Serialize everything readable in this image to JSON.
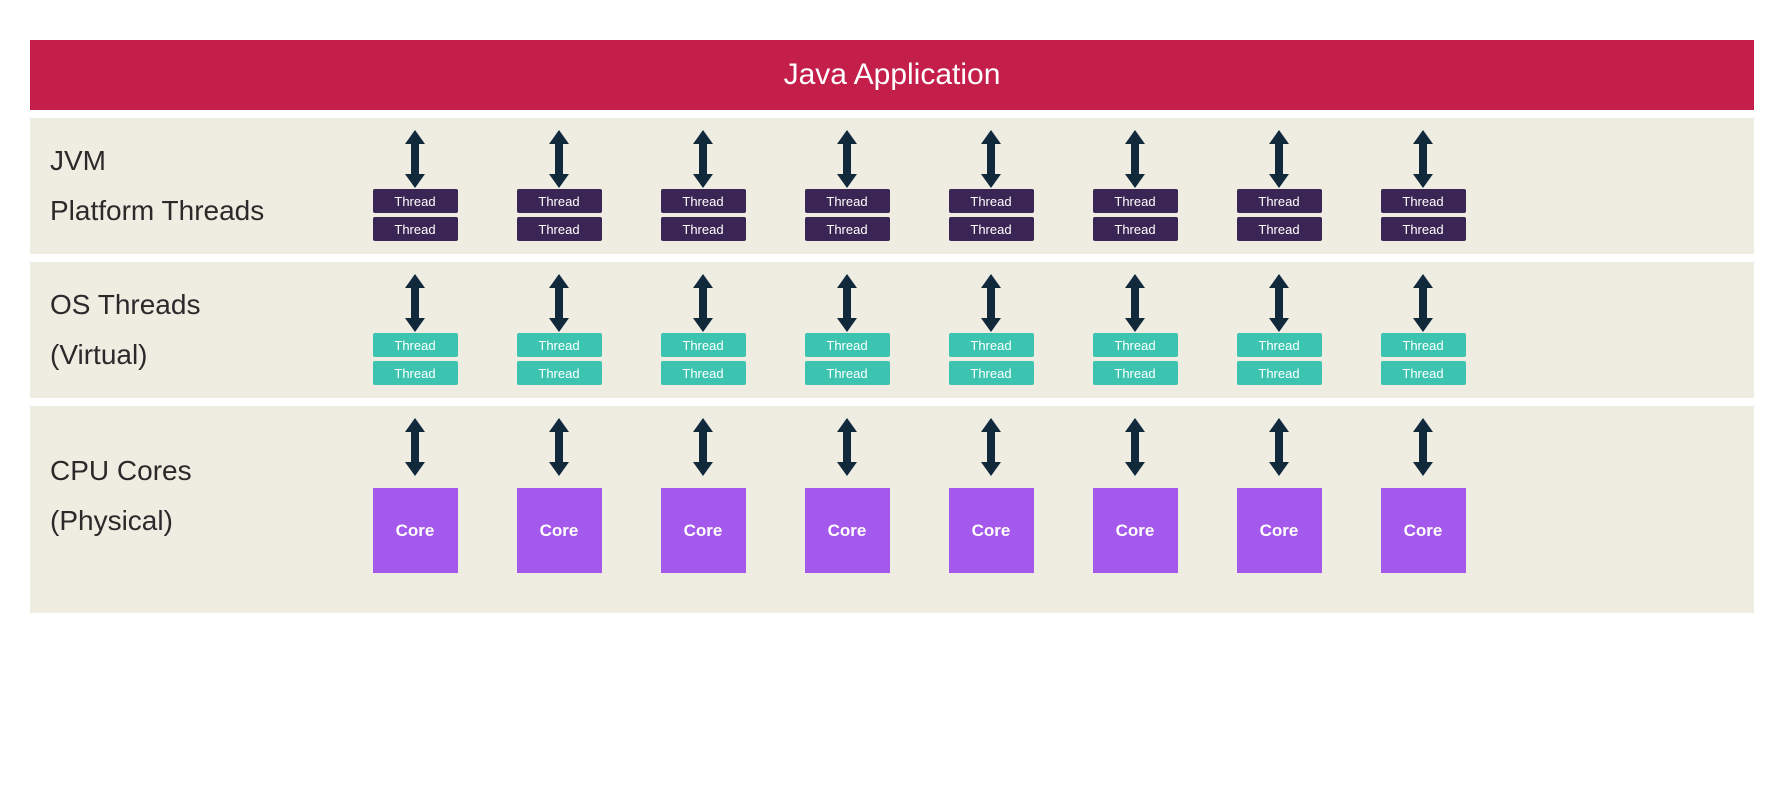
{
  "header": {
    "title": "Java Application"
  },
  "layers": {
    "jvm": {
      "line1": "JVM",
      "line2": "Platform Threads"
    },
    "os": {
      "line1": "OS Threads",
      "line2": "(Virtual)"
    },
    "cpu": {
      "line1": "CPU Cores",
      "line2": "(Physical)"
    }
  },
  "labels": {
    "thread": "Thread",
    "core": "Core"
  },
  "column_count": 8,
  "colors": {
    "header_bg": "#c41e4a",
    "layer_bg": "#efece2",
    "jvm_thread": "#3b2555",
    "os_thread": "#3cc4b0",
    "core": "#a259ec",
    "arrow": "#102a3b"
  }
}
